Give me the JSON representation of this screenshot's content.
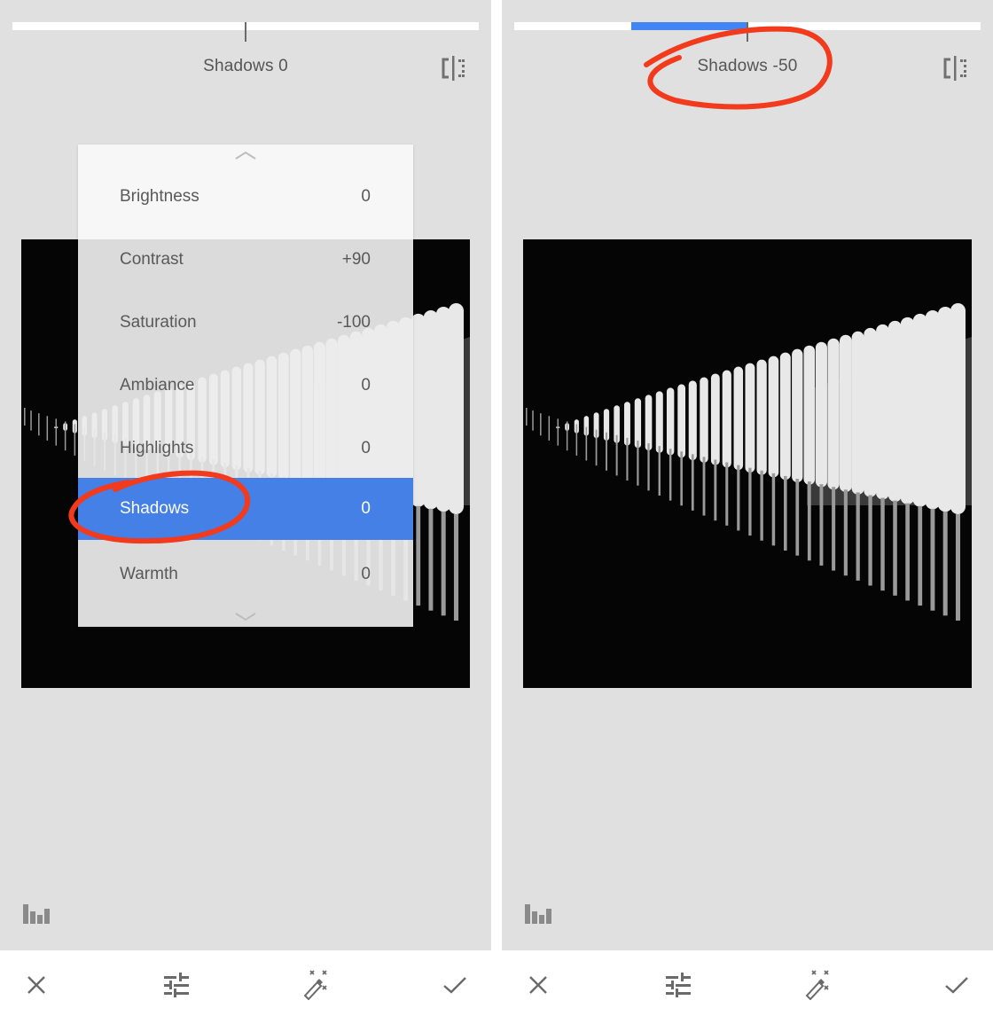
{
  "colors": {
    "accent": "#4285f4",
    "selected_row": "#4480e6",
    "annotation": "#f23a1c",
    "canvas_bg": "#e0e0e0",
    "icon_gray": "#707070"
  },
  "panels": [
    {
      "id": "left",
      "adjustment_label": "Shadows 0",
      "slider": {
        "min": -100,
        "max": 100,
        "value": 0
      },
      "menu_open": true,
      "menu": {
        "items": [
          {
            "label": "Brightness",
            "value": "0"
          },
          {
            "label": "Contrast",
            "value": "+90"
          },
          {
            "label": "Saturation",
            "value": "-100"
          },
          {
            "label": "Ambiance",
            "value": "0"
          },
          {
            "label": "Highlights",
            "value": "0"
          },
          {
            "label": "Shadows",
            "value": "0",
            "selected": true
          },
          {
            "label": "Warmth",
            "value": "0"
          }
        ],
        "scroll_up_icon": "chevron-up-icon",
        "scroll_down_icon": "chevron-down-icon"
      },
      "annotation": "circled Shadows menu item"
    },
    {
      "id": "right",
      "adjustment_label": "Shadows -50",
      "slider": {
        "min": -100,
        "max": 100,
        "value": -50
      },
      "menu_open": false,
      "annotation": "circled Shadows -50 label"
    }
  ],
  "icons": {
    "compare": "compare-icon",
    "histogram": "histogram-icon",
    "cancel": "close-icon",
    "tune": "sliders-icon",
    "auto": "magic-wand-icon",
    "apply": "check-icon"
  }
}
